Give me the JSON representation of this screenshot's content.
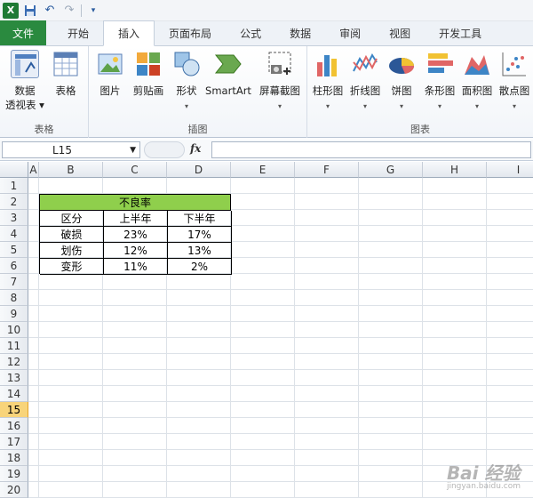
{
  "qat": {
    "app_icon": "X",
    "save_icon": "save-icon",
    "undo_icon": "undo-icon",
    "redo_icon": "redo-icon"
  },
  "tabs": [
    {
      "label": "文件"
    },
    {
      "label": "开始"
    },
    {
      "label": "插入"
    },
    {
      "label": "页面布局"
    },
    {
      "label": "公式"
    },
    {
      "label": "数据"
    },
    {
      "label": "审阅"
    },
    {
      "label": "视图"
    },
    {
      "label": "开发工具"
    }
  ],
  "ribbon": {
    "groups": {
      "table": "表格",
      "illustrations": "插图",
      "charts": "图表"
    },
    "pivot": {
      "line1": "数据",
      "line2": "透视表 ▾"
    },
    "table": "表格",
    "picture": "图片",
    "clipart": "剪贴画",
    "shapes": "形状",
    "smartart": "SmartArt",
    "screenshot": "屏幕截图",
    "charts": [
      "柱形图",
      "折线图",
      "饼图",
      "条形图",
      "面积图",
      "散点图"
    ]
  },
  "formula_bar": {
    "name_box": "L15",
    "fx": "fx"
  },
  "columns": [
    "A",
    "B",
    "C",
    "D",
    "E",
    "F",
    "G",
    "H",
    "I"
  ],
  "rows": [
    "1",
    "2",
    "3",
    "4",
    "5",
    "6",
    "7",
    "8",
    "9",
    "10",
    "11",
    "12",
    "13",
    "14",
    "15",
    "16",
    "17",
    "18",
    "19",
    "20"
  ],
  "selected_row": "15",
  "sheet": {
    "title": "不良率",
    "headers": [
      "区分",
      "上半年",
      "下半年"
    ],
    "rows": [
      [
        "破损",
        "23%",
        "17%"
      ],
      [
        "划伤",
        "12%",
        "13%"
      ],
      [
        "变形",
        "11%",
        "2%"
      ]
    ]
  },
  "watermark": {
    "main": "Bai 经验",
    "sub": "jingyan.baidu.com"
  }
}
